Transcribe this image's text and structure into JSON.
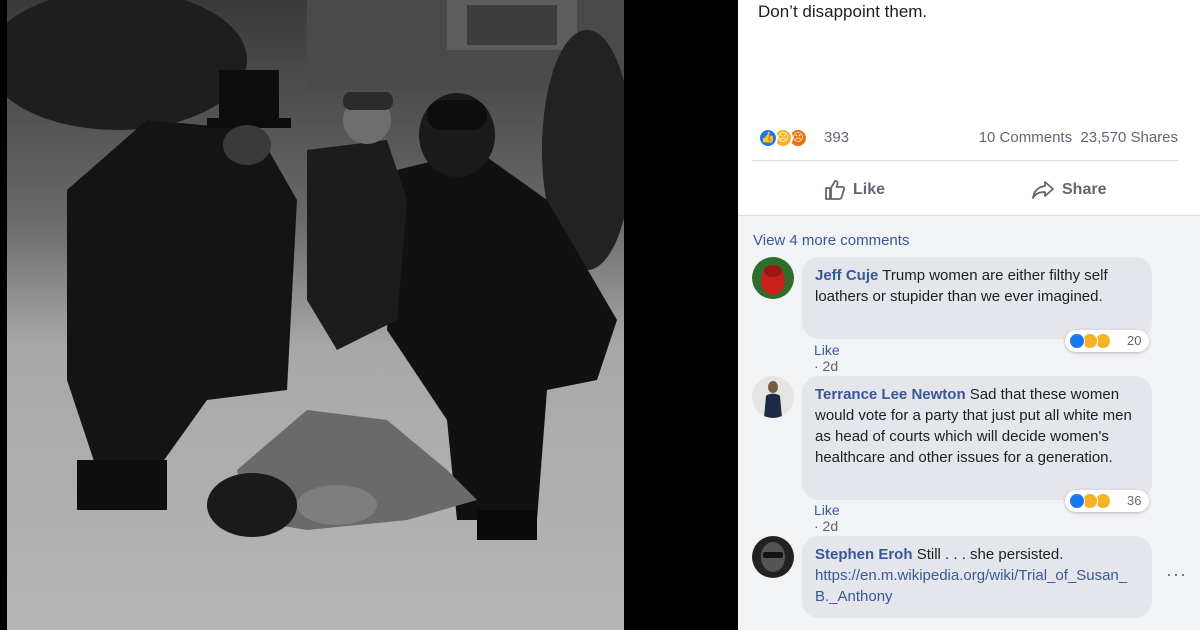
{
  "post": {
    "caption": "Don’t disappoint them.",
    "reaction_count": "393",
    "reactions": [
      "like-icon",
      "sad-icon",
      "angry-icon"
    ],
    "comments_count": "10 Comments",
    "shares_count": "23,570 Shares",
    "like_label": "Like",
    "share_label": "Share"
  },
  "comments": {
    "view_more": "View 4 more comments",
    "items": [
      {
        "author": "Jeff Cuje",
        "text": "Trump women are either filthy self loathers or stupider than we ever imagined.",
        "like_label": "Like",
        "time": "· 2d",
        "reactions": [
          "like-icon",
          "haha-icon",
          "sad-icon"
        ],
        "reaction_count": "20"
      },
      {
        "author": "Terrance Lee Newton",
        "text": "Sad that these women would vote for a party that just put all white men as head of courts which will decide women's healthcare and other issues for a generation.",
        "like_label": "Like",
        "time": "· 2d",
        "reactions": [
          "like-icon",
          "sad-icon",
          "haha-icon"
        ],
        "reaction_count": "36"
      },
      {
        "author": "Stephen Eroh",
        "text": "Still . . . she persisted.",
        "link": "https://en.m.wikipedia.org/wiki/Trial_of_Susan_B._Anthony"
      }
    ]
  },
  "colors": {
    "link": "#385898",
    "like_blue": "#1877f2",
    "bubble": "#e4e6eb",
    "panel_bg": "#f2f3f5"
  }
}
